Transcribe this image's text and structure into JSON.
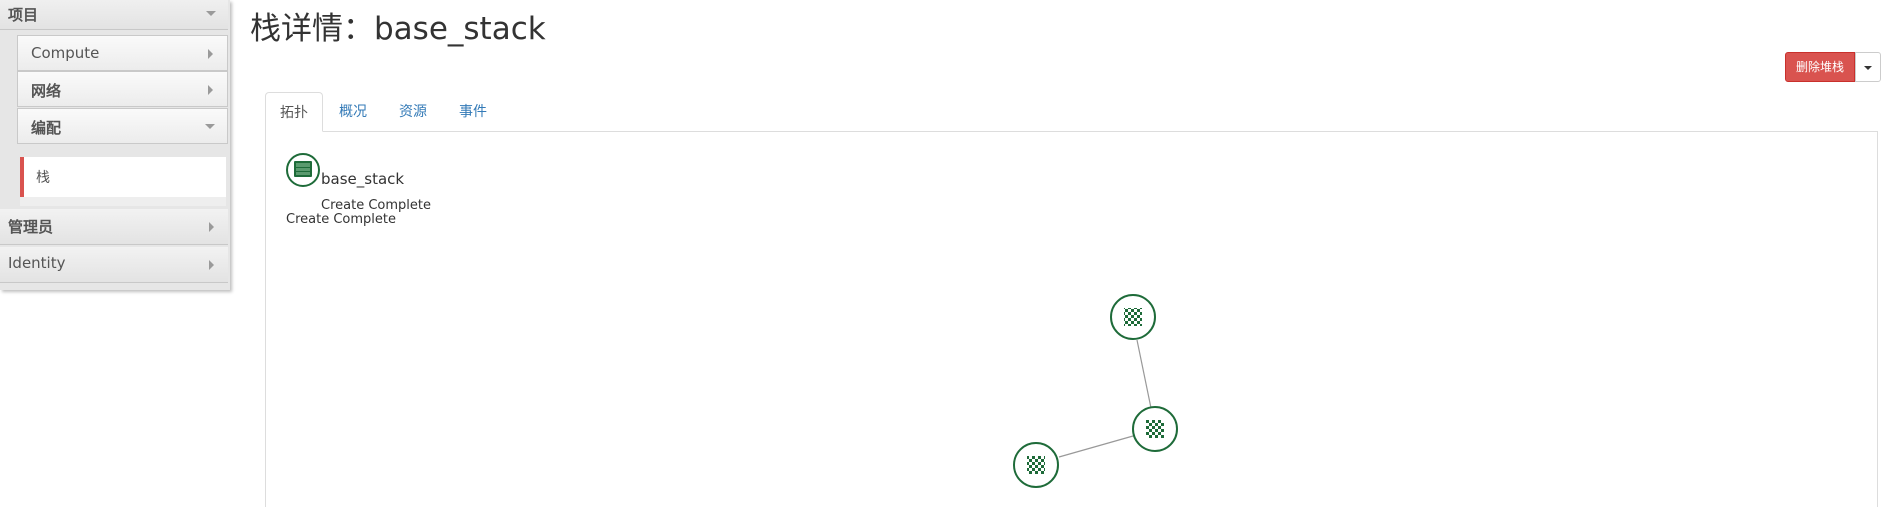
{
  "sidebar": {
    "project_label": "项目",
    "groups": [
      {
        "label": "Compute"
      },
      {
        "label": "网络"
      },
      {
        "label": "编配"
      }
    ],
    "active_item": "栈",
    "admin_label": "管理员",
    "identity_label": "Identity"
  },
  "page": {
    "title": "栈详情：base_stack",
    "delete_button": "删除堆栈"
  },
  "tabs": [
    "拓扑",
    "概况",
    "资源",
    "事件"
  ],
  "topology": {
    "stack_name": "base_stack",
    "stack_status": "Create Complete",
    "stack_status_secondary": "Create Complete",
    "node_color": "#1e6b39",
    "link_color": "#999999",
    "icons": {
      "stack": "server-stack-icon",
      "resource": "checkered-resource-icon"
    }
  },
  "colors": {
    "danger": "#d9534f",
    "accent_bar": "#d9534f",
    "link": "#337ab7"
  }
}
